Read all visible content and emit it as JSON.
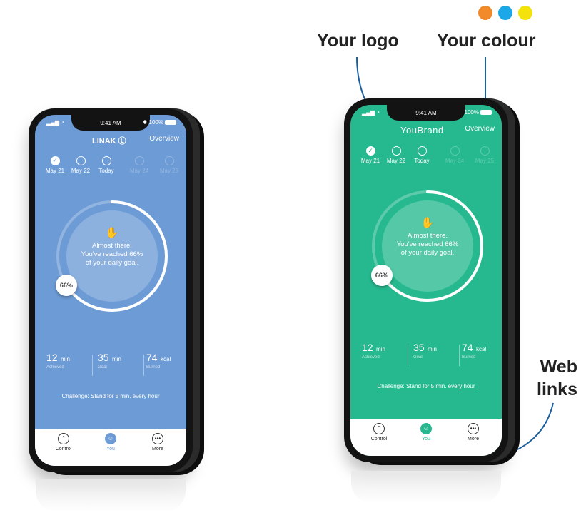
{
  "annotations": {
    "logo": "Your logo",
    "colour": "Your colour",
    "web": "Web",
    "links": "links"
  },
  "swatches": [
    "#f28a2b",
    "#1ba7e8",
    "#f4e20d"
  ],
  "phones": {
    "left": {
      "theme": "#6d9bd6",
      "status": {
        "signal": "▂▄▆ ◔",
        "time": "9:41 AM",
        "battery": "✱ 100%"
      },
      "brand": "LINAK Ⓛ",
      "overview": "Overview",
      "days": [
        {
          "label": "May 21",
          "state": "done"
        },
        {
          "label": "May 22",
          "state": "partial"
        },
        {
          "label": "Today",
          "state": "partial"
        },
        {
          "label": "May 24",
          "state": "future"
        },
        {
          "label": "May 25",
          "state": "future"
        }
      ],
      "hands_icon": "✋",
      "message_line1": "Almost there.",
      "message_line2": "You've reached 66%",
      "message_line3": "of your daily goal.",
      "progress_pct": "66%",
      "progress_fraction": 0.66,
      "stats": [
        {
          "value": "12",
          "unit": "min",
          "label": "Achieved"
        },
        {
          "value": "35",
          "unit": "min",
          "label": "Goal"
        },
        {
          "value": "74",
          "unit": "kcal",
          "label": "Burned"
        }
      ],
      "challenge": "Challenge: Stand for 5 min. every hour",
      "tabs": [
        {
          "label": "Control",
          "icon": "⌃"
        },
        {
          "label": "You",
          "icon": "☺"
        },
        {
          "label": "More",
          "icon": "•••"
        }
      ]
    },
    "right": {
      "theme": "#26b98f",
      "status": {
        "signal": "▂▄▆ ◔",
        "time": "9:41 AM",
        "battery": "100%"
      },
      "brand": "YouBrand",
      "overview": "Overview",
      "days": [
        {
          "label": "May 21",
          "state": "done"
        },
        {
          "label": "May 22",
          "state": "partial"
        },
        {
          "label": "Today",
          "state": "partial"
        },
        {
          "label": "May 24",
          "state": "future"
        },
        {
          "label": "May 25",
          "state": "future"
        }
      ],
      "hands_icon": "✋",
      "message_line1": "Almost there.",
      "message_line2": "You've reached 66%",
      "message_line3": "of your daily goal.",
      "progress_pct": "66%",
      "progress_fraction": 0.66,
      "stats": [
        {
          "value": "12",
          "unit": "min",
          "label": "Achieved"
        },
        {
          "value": "35",
          "unit": "min",
          "label": "Goal"
        },
        {
          "value": "74",
          "unit": "kcal",
          "label": "Burned"
        }
      ],
      "challenge": "Challenge: Stand for 5 min. every hour",
      "tabs": [
        {
          "label": "Control",
          "icon": "⌃"
        },
        {
          "label": "You",
          "icon": "☺"
        },
        {
          "label": "More",
          "icon": "•••"
        }
      ]
    }
  }
}
